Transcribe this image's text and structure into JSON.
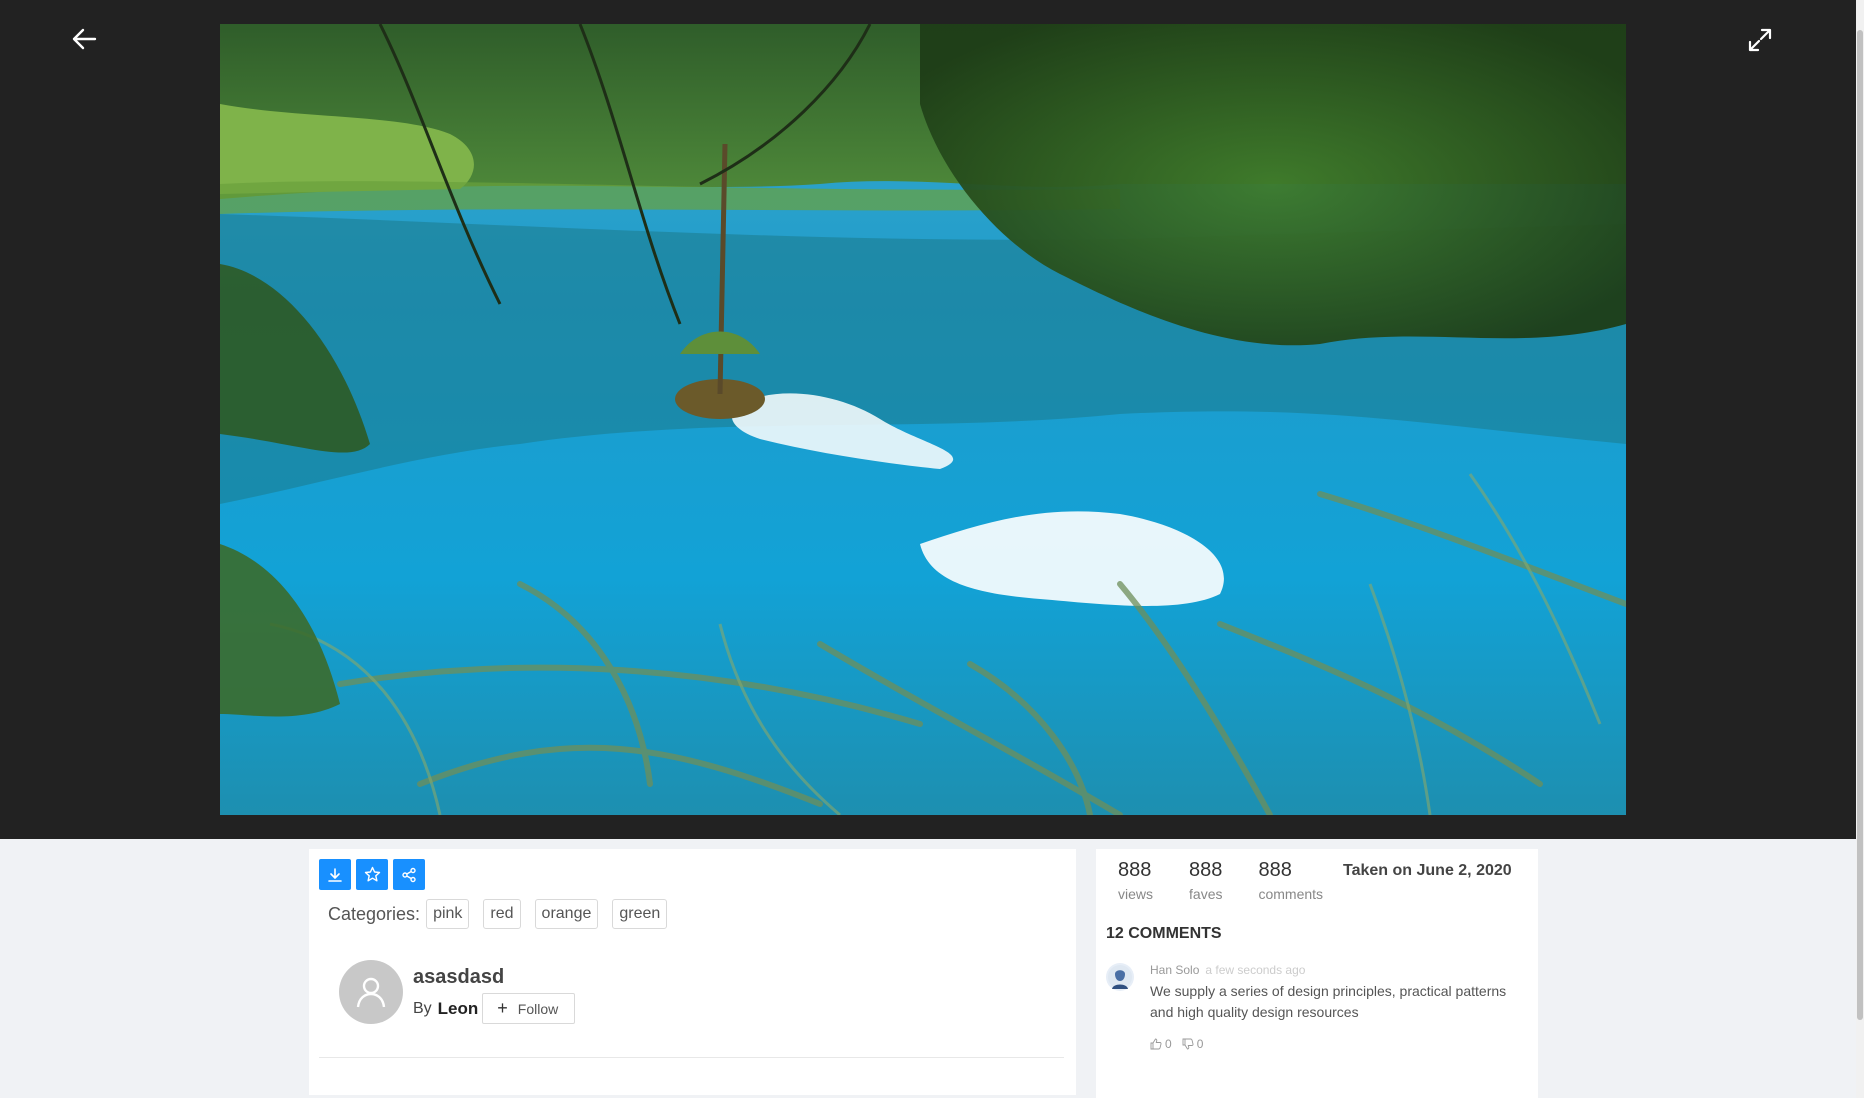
{
  "viewer": {
    "back_icon": "arrow-left-icon",
    "expand_icon": "expand-arrows-icon",
    "photo_description_icon": "lake-photo"
  },
  "actions": [
    {
      "icon": "download-icon"
    },
    {
      "icon": "star-icon"
    },
    {
      "icon": "share-icon"
    }
  ],
  "categories": {
    "label": "Categories:",
    "tags": [
      "pink",
      "red",
      "orange",
      "green"
    ]
  },
  "author": {
    "title": "asasdasd",
    "by_label": "By",
    "name": "Leon",
    "follow_label": "Follow"
  },
  "stats": [
    {
      "value": "888",
      "label": "views"
    },
    {
      "value": "888",
      "label": "faves"
    },
    {
      "value": "888",
      "label": "comments"
    }
  ],
  "taken": "Taken on June 2, 2020",
  "comments": {
    "title": "12 COMMENTS",
    "items": [
      {
        "author": "Han Solo",
        "time": "a few seconds ago",
        "text": "We supply a series of design principles, practical patterns and high quality design resources",
        "likes": "0",
        "dislikes": "0"
      }
    ]
  },
  "colors": {
    "primary": "#1890ff",
    "viewer_bg": "#222222",
    "page_bg": "#f0f2f5"
  }
}
